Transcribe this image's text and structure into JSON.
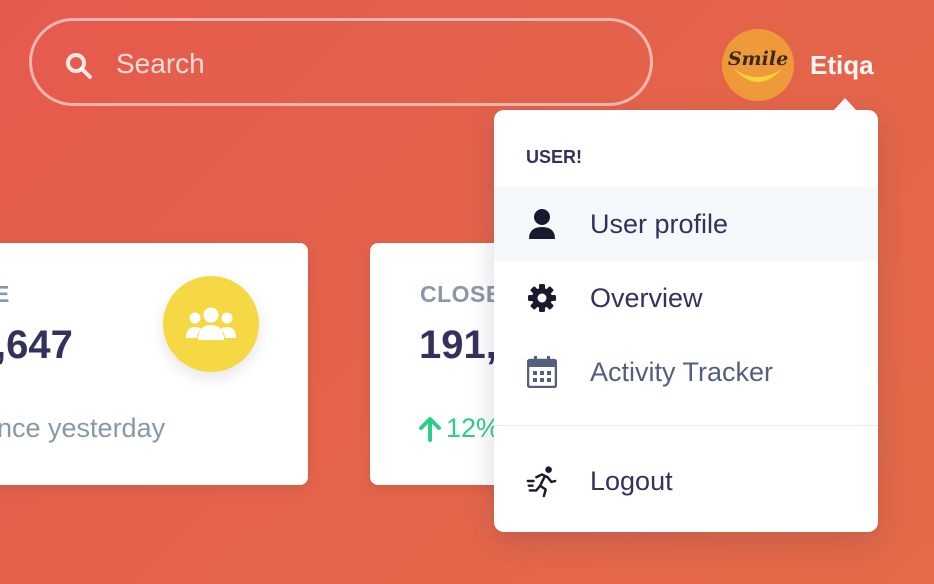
{
  "search": {
    "placeholder": "Search",
    "icon": "search-icon"
  },
  "user": {
    "name": "Etiqa",
    "avatar_text": "Smile"
  },
  "cards": [
    {
      "label": "E",
      "value": ",647",
      "note": "nce yesterday",
      "icon": "users-icon",
      "icon_bg": "#f6d844"
    },
    {
      "label": "CLOSE",
      "value": "191,",
      "trend": "12%",
      "trend_color": "#2dce89"
    }
  ],
  "dropdown": {
    "header": "USER!",
    "items": [
      {
        "label": "User profile",
        "icon": "user-icon"
      },
      {
        "label": "Overview",
        "icon": "gear-icon"
      },
      {
        "label": "Activity Tracker",
        "icon": "calendar-icon"
      },
      {
        "label": "Logout",
        "icon": "running-icon"
      }
    ]
  },
  "colors": {
    "background": "#e55a4e",
    "accent_green": "#2dce89",
    "heading": "#32325d",
    "muted": "#8898aa"
  }
}
